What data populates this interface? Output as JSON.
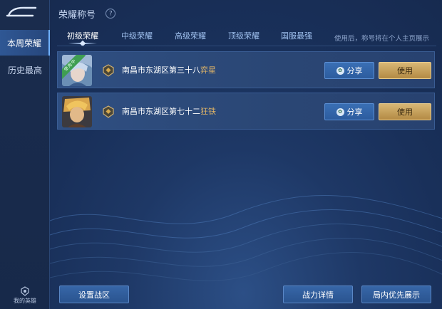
{
  "sidebar": {
    "items": [
      {
        "label": "本周荣耀",
        "active": true
      },
      {
        "label": "历史最高",
        "active": false
      }
    ],
    "my_hero_label": "我的英雄"
  },
  "header": {
    "title": "荣耀称号",
    "help_icon": "?"
  },
  "tabs": [
    {
      "label": "初级荣耀",
      "active": true
    },
    {
      "label": "中级荣耀",
      "active": false
    },
    {
      "label": "高级荣耀",
      "active": false
    },
    {
      "label": "顶级荣耀",
      "active": false
    },
    {
      "label": "国服最强",
      "active": false
    }
  ],
  "tabs_note": "使用后，称号将在个人主页展示",
  "rows": [
    {
      "badge": "使用中",
      "title_prefix": "南昌市东湖区第三十八",
      "hero_name": "弈星",
      "share_label": "分享",
      "use_label": "使用"
    },
    {
      "title_prefix": "南昌市东湖区第七十二",
      "hero_name": "狂铁",
      "share_label": "分享",
      "use_label": "使用"
    }
  ],
  "footer": {
    "set_region_label": "设置战区",
    "power_details_label": "战力详情",
    "priority_display_label": "局内优先展示"
  },
  "colors": {
    "accent_gold": "#e0b467",
    "use_button": "#c9a35a",
    "share_button": "#3566a8",
    "background": "#1b2c4c",
    "active_badge": "#3f9e52"
  }
}
